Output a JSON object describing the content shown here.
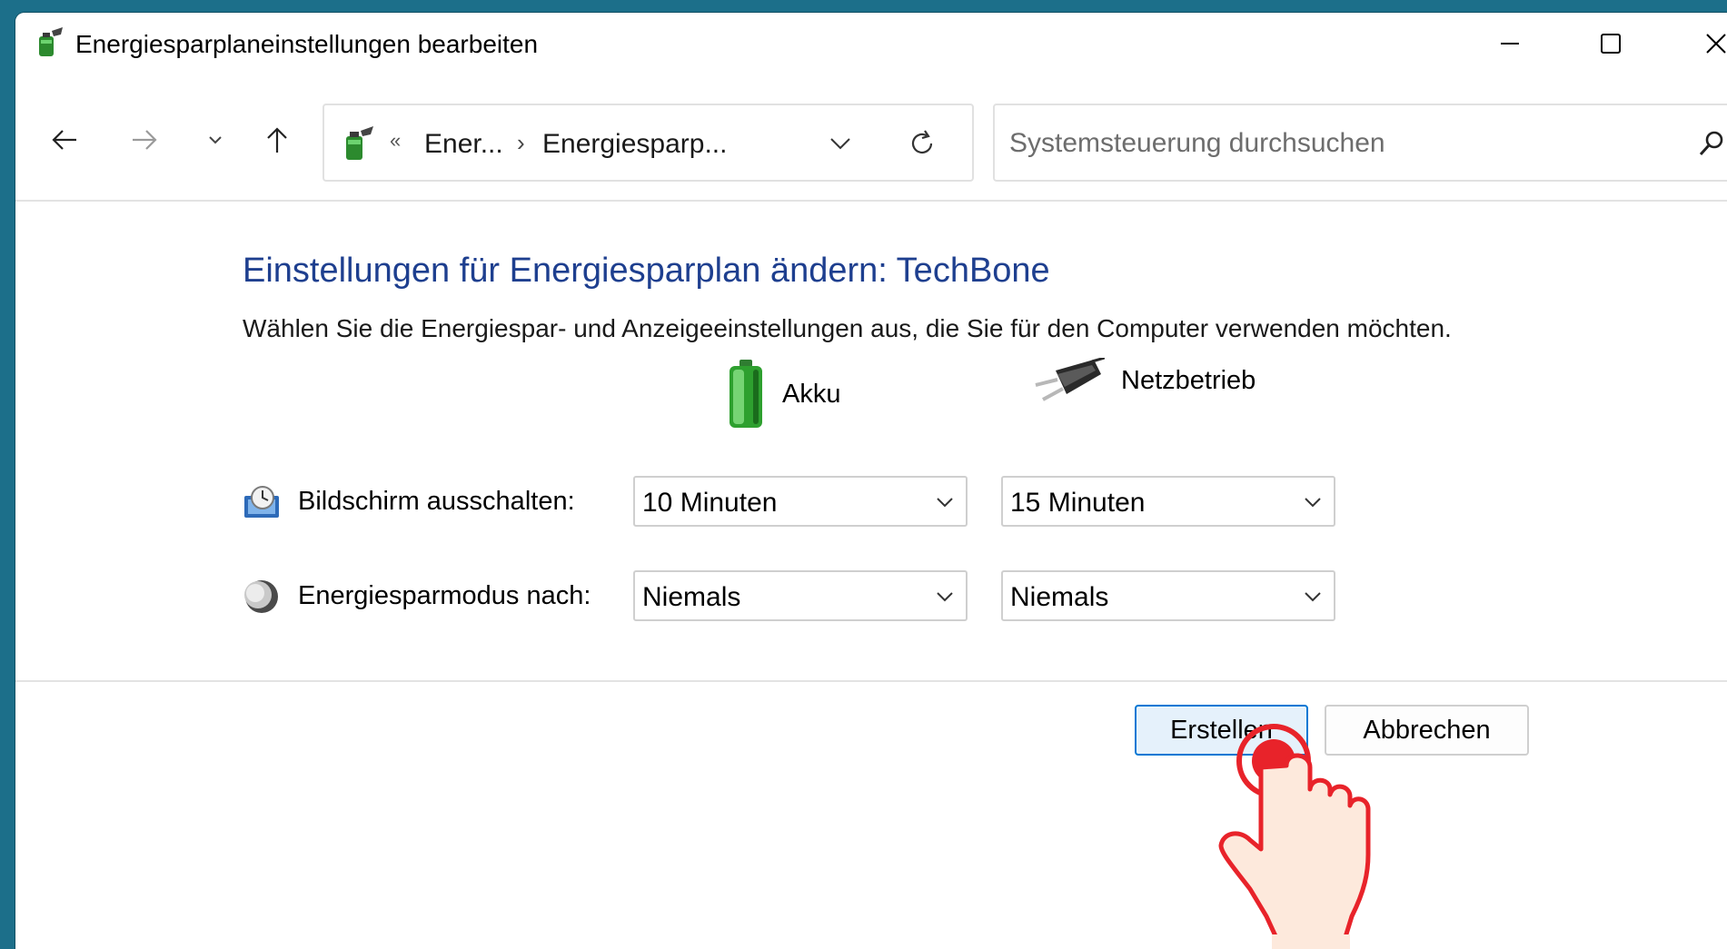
{
  "window": {
    "title": "Energiesparplaneinstellungen bearbeiten",
    "controls": {
      "minimize": "minimize-icon",
      "maximize": "maximize-icon",
      "close": "close-icon"
    }
  },
  "nav": {
    "breadcrumb_prefix": "«",
    "breadcrumb": [
      "Ener...",
      "Energiesparp..."
    ],
    "breadcrumb_sep": "›",
    "search_placeholder": "Systemsteuerung durchsuchen"
  },
  "content": {
    "heading": "Einstellungen für Energiesparplan ändern: TechBone",
    "subtext": "Wählen Sie die Energiespar- und Anzeigeeinstellungen aus, die Sie für den Computer verwenden möchten.",
    "columns": {
      "battery": "Akku",
      "plugged": "Netzbetrieb"
    },
    "rows": [
      {
        "label": "Bildschirm ausschalten:",
        "battery": "10 Minuten",
        "plugged": "15 Minuten",
        "icon": "display-clock-icon"
      },
      {
        "label": "Energiesparmodus nach:",
        "battery": "Niemals",
        "plugged": "Niemals",
        "icon": "moon-icon"
      }
    ]
  },
  "footer": {
    "create_label": "Erstellen",
    "cancel_label": "Abbrechen"
  },
  "colors": {
    "heading": "#1e3f8f",
    "accent_border": "#0078d4",
    "primary_button_bg": "#e5f1fb",
    "desktop_bg": "#1c6f8a",
    "pointer": "#e8232a"
  }
}
